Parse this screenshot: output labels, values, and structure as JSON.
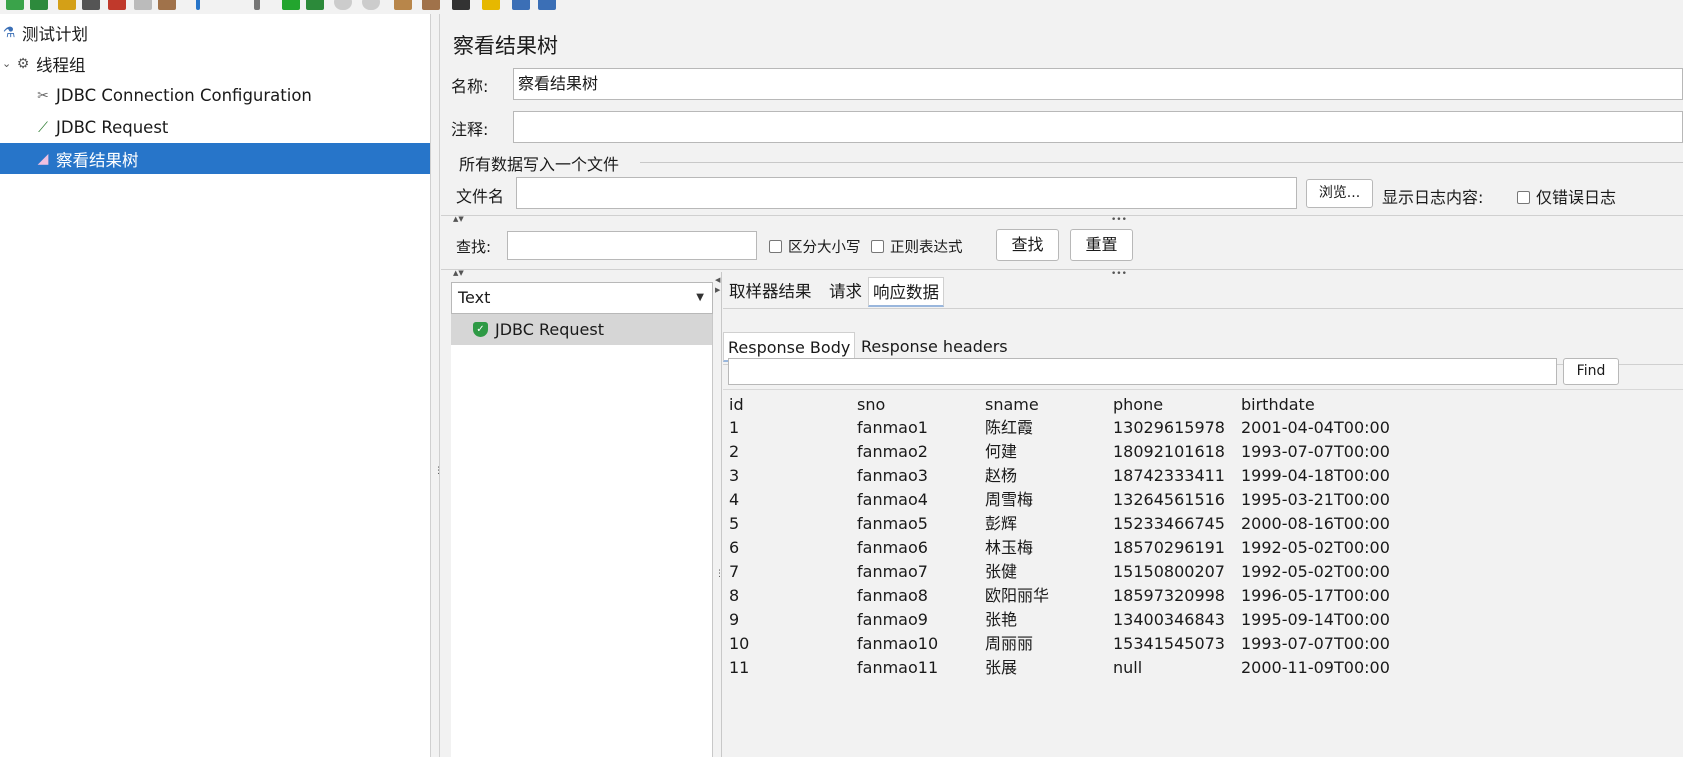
{
  "toolbar": {
    "icons": [
      "new-icon",
      "templates-icon",
      "open-icon",
      "save-icon",
      "cut-icon",
      "copy-icon",
      "paste-icon",
      "expand-icon",
      "toggle-icon",
      "start-icon",
      "start-no-pause-icon",
      "stop-icon",
      "shutdown-icon",
      "clear-icon",
      "clear-all-icon",
      "search-icon",
      "reset-search-icon",
      "function-helper-icon",
      "help-icon"
    ]
  },
  "tree": {
    "items": [
      {
        "label": "测试计划",
        "icon": "test-plan-icon"
      },
      {
        "label": "线程组",
        "icon": "thread-group-icon"
      },
      {
        "label": "JDBC Connection Configuration",
        "icon": "config-tools-icon"
      },
      {
        "label": "JDBC Request",
        "icon": "sampler-dropper-icon"
      },
      {
        "label": "察看结果树",
        "icon": "listener-chart-icon"
      }
    ]
  },
  "panel": {
    "title": "察看结果树",
    "name_label": "名称:",
    "name_value": "察看结果树",
    "comment_label": "注释:",
    "comment_value": "",
    "file_section_title": "所有数据写入一个文件",
    "filename_label": "文件名",
    "filename_value": "",
    "browse_label": "浏览...",
    "log_label": "显示日志内容:",
    "errors_only_label": "仅错误日志"
  },
  "search": {
    "label": "查找:",
    "value": "",
    "case_label": "区分大小写",
    "regex_label": "正则表达式",
    "find_label": "查找",
    "reset_label": "重置"
  },
  "results": {
    "renderer": "Text",
    "samples": [
      {
        "label": "JDBC Request",
        "status": "success"
      }
    ]
  },
  "detail": {
    "tabs": [
      "取样器结果",
      "请求",
      "响应数据"
    ],
    "active_tab": "响应数据",
    "subtabs": [
      "Response Body",
      "Response headers"
    ],
    "find_value": "",
    "find_label": "Find"
  },
  "table": {
    "headers": [
      "id",
      "sno",
      "sname",
      "phone",
      "birthdate"
    ],
    "rows": [
      [
        "1",
        "fanmao1",
        "陈红霞",
        "13029615978",
        "2001-04-04T00:00"
      ],
      [
        "2",
        "fanmao2",
        "何建",
        "18092101618",
        "1993-07-07T00:00"
      ],
      [
        "3",
        "fanmao3",
        "赵杨",
        "18742333411",
        "1999-04-18T00:00"
      ],
      [
        "4",
        "fanmao4",
        "周雪梅",
        "13264561516",
        "1995-03-21T00:00"
      ],
      [
        "5",
        "fanmao5",
        "彭辉",
        "15233466745",
        "2000-08-16T00:00"
      ],
      [
        "6",
        "fanmao6",
        "林玉梅",
        "18570296191",
        "1992-05-02T00:00"
      ],
      [
        "7",
        "fanmao7",
        "张健",
        "15150800207",
        "1992-05-02T00:00"
      ],
      [
        "8",
        "fanmao8",
        "欧阳丽华",
        "18597320998",
        "1996-05-17T00:00"
      ],
      [
        "9",
        "fanmao9",
        "张艳",
        "13400346843",
        "1995-09-14T00:00"
      ],
      [
        "10",
        "fanmao10",
        "周丽丽",
        "15341545073",
        "1993-07-07T00:00"
      ],
      [
        "11",
        "fanmao11",
        "张展",
        "null",
        "2000-11-09T00:00"
      ]
    ]
  },
  "colors": {
    "selection": "#2775c9",
    "success": "#2e9a45"
  }
}
